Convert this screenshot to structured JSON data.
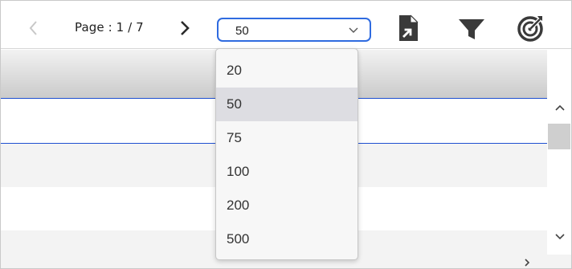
{
  "pagination": {
    "page_label": "Page : 1 / 7",
    "prev_icon": "chevron-left-icon",
    "next_icon": "chevron-right-icon"
  },
  "page_size": {
    "selected": "50",
    "options": [
      "20",
      "50",
      "75",
      "100",
      "200",
      "500"
    ]
  },
  "toolbar_icons": [
    "export-document-icon",
    "filter-icon",
    "target-icon"
  ],
  "colors": {
    "accent": "#2f6be0",
    "selection_border": "#1e4fd0",
    "icon": "#3a3a3a",
    "disabled": "#c8c8c8"
  }
}
